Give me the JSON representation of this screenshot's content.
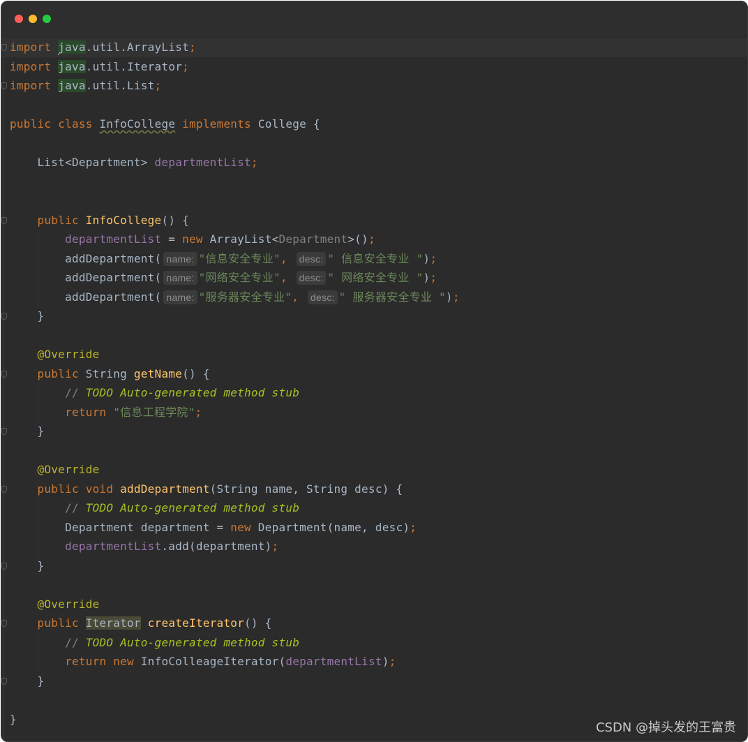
{
  "window": {
    "traffic_lights": [
      "close",
      "minimize",
      "maximize"
    ],
    "colors": {
      "close": "#ff5f56",
      "minimize": "#ffbd2e",
      "maximize": "#27c93f",
      "background": "#2b2b2b"
    }
  },
  "code": {
    "import_kw": "import",
    "import1_pkg": "java",
    "import1_rest": ".util.ArrayList",
    "import2_pkg": "java",
    "import2_rest": ".util.Iterator",
    "import3_pkg": "java",
    "import3_rest": ".util.List",
    "semi": ";",
    "class_public": "public",
    "class_kw": "class",
    "class_name": "InfoCollege",
    "implements_kw": "implements",
    "iface": "College {",
    "field_type": "List<Department>",
    "field_name": "departmentList",
    "ctor_public": "public",
    "ctor_name": "InfoCollege",
    "ctor_rest": "() {",
    "ctor_field": "departmentList",
    "ctor_assign": " = ",
    "new_kw": "new",
    "arraylist": "ArrayList<",
    "generic_dept": "Department",
    "arraylist_close": ">()",
    "add_call": "addDepartment(",
    "hint_name": "name:",
    "hint_desc": "desc:",
    "dept1_name": "\"信息安全专业\"",
    "dept1_desc": "\" 信息安全专业 \"",
    "dept2_name": "\"网络安全专业\"",
    "dept2_desc": "\" 网络安全专业 \"",
    "dept3_name": "\"服务器安全专业\"",
    "dept3_desc": "\" 服务器安全专业 \"",
    "close_call": ")",
    "comma": ",",
    "brace_close": "}",
    "override": "@Override",
    "m1_public": "public",
    "m1_type": "String",
    "m1_name": "getName",
    "m1_rest": "() {",
    "todo_slashes": "// ",
    "todo_text": "TODO Auto-generated method stub",
    "return_kw": "return",
    "m1_return_str": "\"信息工程学院\"",
    "m2_public": "public",
    "m2_void": "void",
    "m2_name": "addDepartment",
    "m2_params": "(String name, String desc) {",
    "m2_decl": "Department department = ",
    "m2_new_call": "Department(name, desc)",
    "m2_field": "departmentList",
    "m2_add": ".add(department)",
    "m3_public": "public",
    "m3_type": "Iterator",
    "m3_name": "createIterator",
    "m3_rest": "() {",
    "m3_iter": "InfoColleageIterator(",
    "m3_field": "departmentList",
    "m3_close": ")",
    "final_brace": "}"
  },
  "watermark": "CSDN @掉头发的王富贵"
}
